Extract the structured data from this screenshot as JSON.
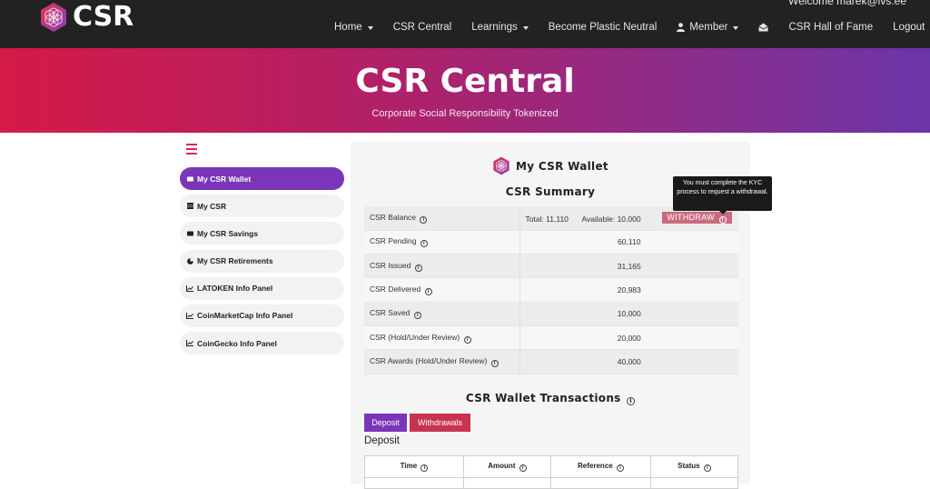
{
  "header": {
    "brand": "CSR",
    "welcome": "Welcome marek@ivs.ee",
    "nav": [
      {
        "label": "Home",
        "dropdown": true
      },
      {
        "label": "CSR Central",
        "dropdown": false
      },
      {
        "label": "Learnings",
        "dropdown": true
      },
      {
        "label": "Become Plastic Neutral",
        "dropdown": false
      },
      {
        "label": "Member",
        "dropdown": true
      },
      {
        "label": "CSR Hall of Fame",
        "dropdown": false
      },
      {
        "label": "Logout",
        "dropdown": false
      }
    ]
  },
  "hero": {
    "title": "CSR Central",
    "subtitle": "Corporate Social Responsibility Tokenized"
  },
  "sidebar": {
    "items": [
      {
        "label": "My CSR Wallet",
        "icon": "wallet-icon"
      },
      {
        "label": "My CSR",
        "icon": "coins-icon"
      },
      {
        "label": "My CSR Savings",
        "icon": "wallet-icon"
      },
      {
        "label": "My CSR Retirements",
        "icon": "pie-chart-icon"
      },
      {
        "label": "LATOKEN Info Panel",
        "icon": "line-chart-icon"
      },
      {
        "label": "CoinMarketCap Info Panel",
        "icon": "line-chart-icon"
      },
      {
        "label": "CoinGecko Info Panel",
        "icon": "line-chart-icon"
      }
    ]
  },
  "wallet": {
    "title": "My CSR Wallet",
    "summary_title": "CSR Summary",
    "balance_label": "CSR Balance",
    "total": "Total: 11,110",
    "available": "Available: 10,000",
    "withdraw_label": "WITHDRAW",
    "tooltip": "You must complete the KYC process to request a withdrawal.",
    "rows": [
      {
        "label": "CSR Pending",
        "value": "60,110"
      },
      {
        "label": "CSR Issued",
        "value": "31,165"
      },
      {
        "label": "CSR Delivered",
        "value": "20,983"
      },
      {
        "label": "CSR Saved",
        "value": "10,000"
      },
      {
        "label": "CSR (Hold/Under Review)",
        "value": "20,000"
      },
      {
        "label": "CSR Awards (Hold/Under Review)",
        "value": "40,000"
      }
    ]
  },
  "transactions": {
    "title": "CSR Wallet Transactions",
    "deposit_button": "Deposit",
    "withdrawals_button": "Withdrawals",
    "section_label": "Deposit",
    "columns": [
      "Time",
      "Amount",
      "Reference",
      "Status"
    ]
  },
  "colors": {
    "nav_bg": "#222222",
    "accent_purple": "#7a35b8",
    "accent_red": "#c8344f"
  }
}
